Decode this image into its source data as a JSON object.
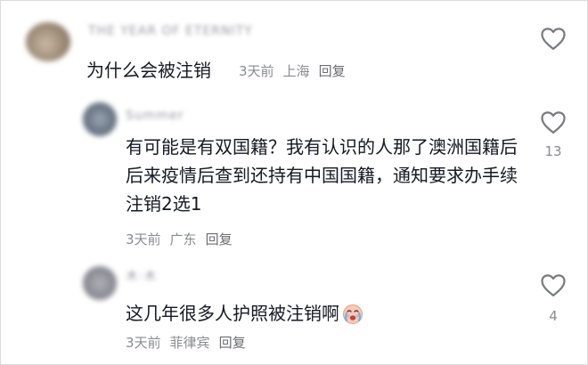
{
  "comments": [
    {
      "username": "THE YEAR OF ETERNITY",
      "text": "为什么会被注销",
      "time": "3天前",
      "location": "上海",
      "reply_label": "回复"
    },
    {
      "username": "Summer",
      "text": "有可能是有双国籍？我有认识的人那了澳洲国籍后后来疫情后查到还持有中国国籍，通知要求办手续注销2选1",
      "time": "3天前",
      "location": "广东",
      "reply_label": "回复",
      "likes": "13"
    },
    {
      "username": "木·木",
      "text": "这几年很多人护照被注销啊",
      "emoji": "crying-face-emoji",
      "time": "3天前",
      "location": "菲律宾",
      "reply_label": "回复",
      "likes": "4"
    }
  ],
  "icons": {
    "like": "heart-outline-icon"
  },
  "colors": {
    "text": "#161823",
    "meta": "#8a8b91",
    "background": "#ffffff"
  }
}
